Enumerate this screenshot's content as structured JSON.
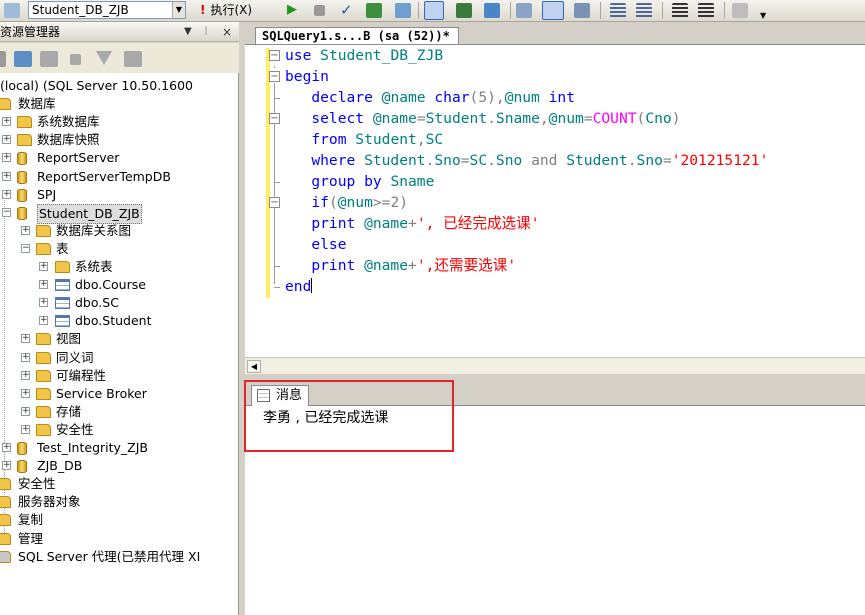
{
  "toolbar": {
    "database": "Student_DB_ZJB",
    "execute_label": "执行(X)"
  },
  "object_explorer": {
    "title": "资源管理器",
    "title_buttons": [
      "▼",
      "ᛁ",
      "×"
    ],
    "tree": [
      {
        "label": "(local) (SQL Server 10.50.1600",
        "level": 0,
        "icon": "server",
        "expander": ""
      },
      {
        "label": "数据库",
        "level": 0,
        "icon": "folder",
        "expander": ""
      },
      {
        "label": "系统数据库",
        "level": 1,
        "icon": "folder",
        "expander": "+"
      },
      {
        "label": "数据库快照",
        "level": 1,
        "icon": "folder",
        "expander": "+"
      },
      {
        "label": "ReportServer",
        "level": 1,
        "icon": "database",
        "expander": "+"
      },
      {
        "label": "ReportServerTempDB",
        "level": 1,
        "icon": "database",
        "expander": "+"
      },
      {
        "label": "SPJ",
        "level": 1,
        "icon": "database",
        "expander": "+"
      },
      {
        "label": "Student_DB_ZJB",
        "level": 1,
        "icon": "database",
        "expander": "−",
        "selected": true
      },
      {
        "label": "数据库关系图",
        "level": 2,
        "icon": "folder",
        "expander": "+"
      },
      {
        "label": "表",
        "level": 2,
        "icon": "folder",
        "expander": "−"
      },
      {
        "label": "系统表",
        "level": 3,
        "icon": "folder",
        "expander": "+"
      },
      {
        "label": "dbo.Course",
        "level": 3,
        "icon": "table",
        "expander": "+"
      },
      {
        "label": "dbo.SC",
        "level": 3,
        "icon": "table",
        "expander": "+"
      },
      {
        "label": "dbo.Student",
        "level": 3,
        "icon": "table",
        "expander": "+"
      },
      {
        "label": "视图",
        "level": 2,
        "icon": "folder",
        "expander": "+"
      },
      {
        "label": "同义词",
        "level": 2,
        "icon": "folder",
        "expander": "+"
      },
      {
        "label": "可编程性",
        "level": 2,
        "icon": "folder",
        "expander": "+"
      },
      {
        "label": "Service Broker",
        "level": 2,
        "icon": "folder",
        "expander": "+"
      },
      {
        "label": "存储",
        "level": 2,
        "icon": "folder",
        "expander": "+"
      },
      {
        "label": "安全性",
        "level": 2,
        "icon": "folder",
        "expander": "+"
      },
      {
        "label": "Test_Integrity_ZJB",
        "level": 1,
        "icon": "database",
        "expander": "+"
      },
      {
        "label": "ZJB_DB",
        "level": 1,
        "icon": "database",
        "expander": "+"
      },
      {
        "label": "安全性",
        "level": 0,
        "icon": "folder",
        "expander": ""
      },
      {
        "label": "服务器对象",
        "level": 0,
        "icon": "folder",
        "expander": ""
      },
      {
        "label": "复制",
        "level": 0,
        "icon": "folder",
        "expander": ""
      },
      {
        "label": "管理",
        "level": 0,
        "icon": "folder",
        "expander": ""
      },
      {
        "label": "SQL Server 代理(已禁用代理 XI",
        "level": 0,
        "icon": "agent",
        "expander": ""
      }
    ]
  },
  "editor": {
    "tab_label": "SQLQuery1.s...B (sa (52))*",
    "lines": [
      [
        {
          "t": "use ",
          "c": "kw"
        },
        {
          "t": "Student_DB_ZJB",
          "c": "cn"
        }
      ],
      [
        {
          "t": "begin",
          "c": "kw"
        }
      ],
      [
        {
          "t": "   declare ",
          "c": "kw"
        },
        {
          "t": "@name ",
          "c": "var"
        },
        {
          "t": "char",
          "c": "kw"
        },
        {
          "t": "(5),",
          "c": "gray"
        },
        {
          "t": "@num ",
          "c": "var"
        },
        {
          "t": "int",
          "c": "kw"
        }
      ],
      [
        {
          "t": "   select ",
          "c": "kw"
        },
        {
          "t": "@name",
          "c": "var"
        },
        {
          "t": "=",
          "c": "gray"
        },
        {
          "t": "Student",
          "c": "cn"
        },
        {
          "t": ".",
          "c": "gray"
        },
        {
          "t": "Sname",
          "c": "cn"
        },
        {
          "t": ",",
          "c": "gray"
        },
        {
          "t": "@num",
          "c": "var"
        },
        {
          "t": "=",
          "c": "gray"
        },
        {
          "t": "COUNT",
          "c": "fn"
        },
        {
          "t": "(",
          "c": "gray"
        },
        {
          "t": "Cno",
          "c": "cn"
        },
        {
          "t": ")",
          "c": "gray"
        }
      ],
      [
        {
          "t": "   from ",
          "c": "kw"
        },
        {
          "t": "Student",
          "c": "cn"
        },
        {
          "t": ",",
          "c": "gray"
        },
        {
          "t": "SC",
          "c": "cn"
        }
      ],
      [
        {
          "t": "   where ",
          "c": "kw"
        },
        {
          "t": "Student",
          "c": "cn"
        },
        {
          "t": ".",
          "c": "gray"
        },
        {
          "t": "Sno",
          "c": "cn"
        },
        {
          "t": "=",
          "c": "gray"
        },
        {
          "t": "SC",
          "c": "cn"
        },
        {
          "t": ".",
          "c": "gray"
        },
        {
          "t": "Sno ",
          "c": "cn"
        },
        {
          "t": "and ",
          "c": "gray"
        },
        {
          "t": "Student",
          "c": "cn"
        },
        {
          "t": ".",
          "c": "gray"
        },
        {
          "t": "Sno",
          "c": "cn"
        },
        {
          "t": "=",
          "c": "gray"
        },
        {
          "t": "'201215121'",
          "c": "str"
        }
      ],
      [
        {
          "t": "   group by ",
          "c": "kw"
        },
        {
          "t": "Sname",
          "c": "cn"
        }
      ],
      [
        {
          "t": "   if",
          "c": "kw"
        },
        {
          "t": "(",
          "c": "gray"
        },
        {
          "t": "@num",
          "c": "var"
        },
        {
          "t": ">=2)",
          "c": "gray"
        }
      ],
      [
        {
          "t": "   print ",
          "c": "kw"
        },
        {
          "t": "@name",
          "c": "var"
        },
        {
          "t": "+",
          "c": "gray"
        },
        {
          "t": "', 已经完成选课'",
          "c": "str"
        }
      ],
      [
        {
          "t": "   else",
          "c": "kw"
        }
      ],
      [
        {
          "t": "   print ",
          "c": "kw"
        },
        {
          "t": "@name",
          "c": "var"
        },
        {
          "t": "+",
          "c": "gray"
        },
        {
          "t": "',还需要选课'",
          "c": "str"
        }
      ],
      [
        {
          "t": "end",
          "c": "kw"
        }
      ]
    ]
  },
  "results": {
    "tab_label": "消息",
    "message": "李勇 , 已经完成选课"
  },
  "colors": {
    "keyword": "#0000ff",
    "variable": "#008080",
    "function": "#ff00ff",
    "string": "#ff0000",
    "highlight_box": "#e0252a"
  }
}
